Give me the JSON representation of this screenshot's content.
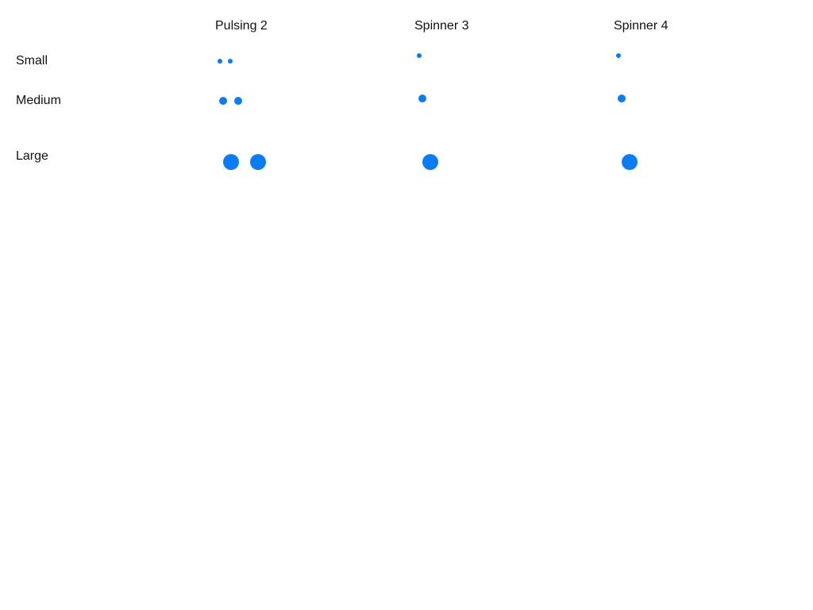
{
  "columns": [
    {
      "label": "Pulsing 2"
    },
    {
      "label": "Spinner 3"
    },
    {
      "label": "Spinner 4"
    }
  ],
  "rows": [
    {
      "label": "Small"
    },
    {
      "label": "Medium"
    },
    {
      "label": "Large"
    }
  ],
  "colors": {
    "accent": "#0a7cf5",
    "text": "#111111",
    "background": "#ffffff"
  }
}
